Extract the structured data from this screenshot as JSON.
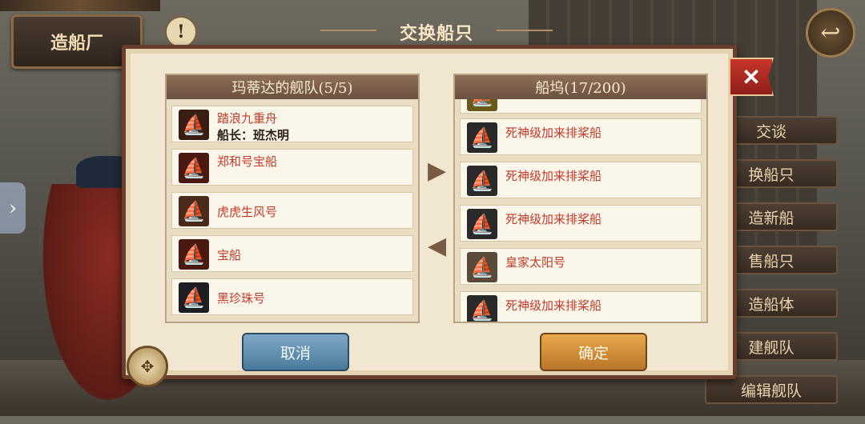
{
  "top": {
    "shipyard_label": "造船厂",
    "alert_glyph": "!",
    "back_glyph": "↩",
    "expand_glyph": "›"
  },
  "modal": {
    "title": "交换船只",
    "close_glyph": "✕",
    "left_panel": {
      "title": "玛蒂达的舰队(5/5)",
      "ships": [
        {
          "name": "踏浪九重舟",
          "captain": "船长：班杰明",
          "icon": "junk-ship-icon"
        },
        {
          "name": "郑和号宝船",
          "captain": "",
          "icon": "treasure-ship-icon"
        },
        {
          "name": "虎虎生风号",
          "captain": "",
          "icon": "galleon-icon"
        },
        {
          "name": "宝船",
          "captain": "",
          "icon": "treasure-ship-icon"
        },
        {
          "name": "黑珍珠号",
          "captain": "",
          "icon": "black-ship-icon"
        }
      ]
    },
    "right_panel": {
      "title": "船坞(17/200)",
      "ships": [
        {
          "name": "",
          "icon": "yellow-ship-icon"
        },
        {
          "name": "死神级加来排桨船",
          "icon": "galley-icon"
        },
        {
          "name": "死神级加来排桨船",
          "icon": "galley-icon"
        },
        {
          "name": "死神级加来排桨船",
          "icon": "galley-icon"
        },
        {
          "name": "皇家太阳号",
          "icon": "white-sail-ship-icon"
        },
        {
          "name": "死神级加来排桨船",
          "icon": "galley-icon"
        }
      ]
    },
    "transfer_right_glyph": "▶",
    "transfer_left_glyph": "◀",
    "cancel_label": "取消",
    "confirm_label": "确定"
  },
  "side_menu": [
    "交谈",
    "换船只",
    "造新船",
    "售船只",
    "造船体",
    "建舰队",
    "编辑舰队"
  ]
}
